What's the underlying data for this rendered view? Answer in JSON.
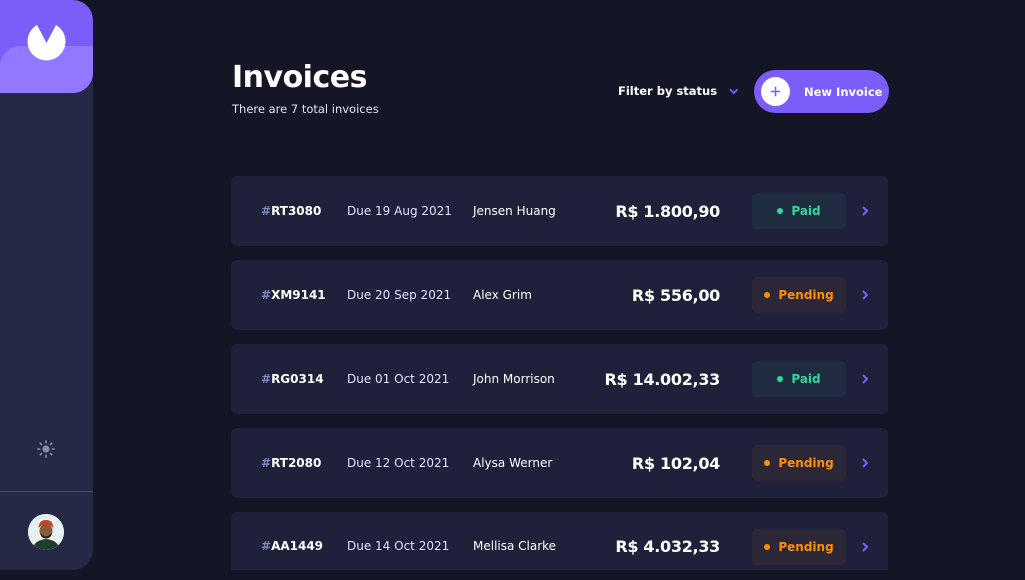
{
  "header": {
    "title": "Invoices",
    "subtitle": "There are 7 total invoices",
    "filter_label": "Filter by status",
    "new_button_label": "New Invoice"
  },
  "sidebar": {
    "logo_icon": "logo-icon",
    "theme_icon": "sun-icon",
    "avatar": "user-avatar"
  },
  "colors": {
    "accent": "#7c5dfa",
    "paid": "#33d69f",
    "pending": "#ff8f00"
  },
  "invoices": [
    {
      "hash": "#",
      "id": "RT3080",
      "due": "Due 19 Aug 2021",
      "client": "Jensen Huang",
      "amount": "R$ 1.800,90",
      "status": "Paid"
    },
    {
      "hash": "#",
      "id": "XM9141",
      "due": "Due 20 Sep 2021",
      "client": "Alex Grim",
      "amount": "R$ 556,00",
      "status": "Pending"
    },
    {
      "hash": "#",
      "id": "RG0314",
      "due": "Due 01 Oct 2021",
      "client": "John Morrison",
      "amount": "R$ 14.002,33",
      "status": "Paid"
    },
    {
      "hash": "#",
      "id": "RT2080",
      "due": "Due 12 Oct 2021",
      "client": "Alysa Werner",
      "amount": "R$ 102,04",
      "status": "Pending"
    },
    {
      "hash": "#",
      "id": "AA1449",
      "due": "Due 14 Oct 2021",
      "client": "Mellisa Clarke",
      "amount": "R$ 4.032,33",
      "status": "Pending"
    }
  ]
}
